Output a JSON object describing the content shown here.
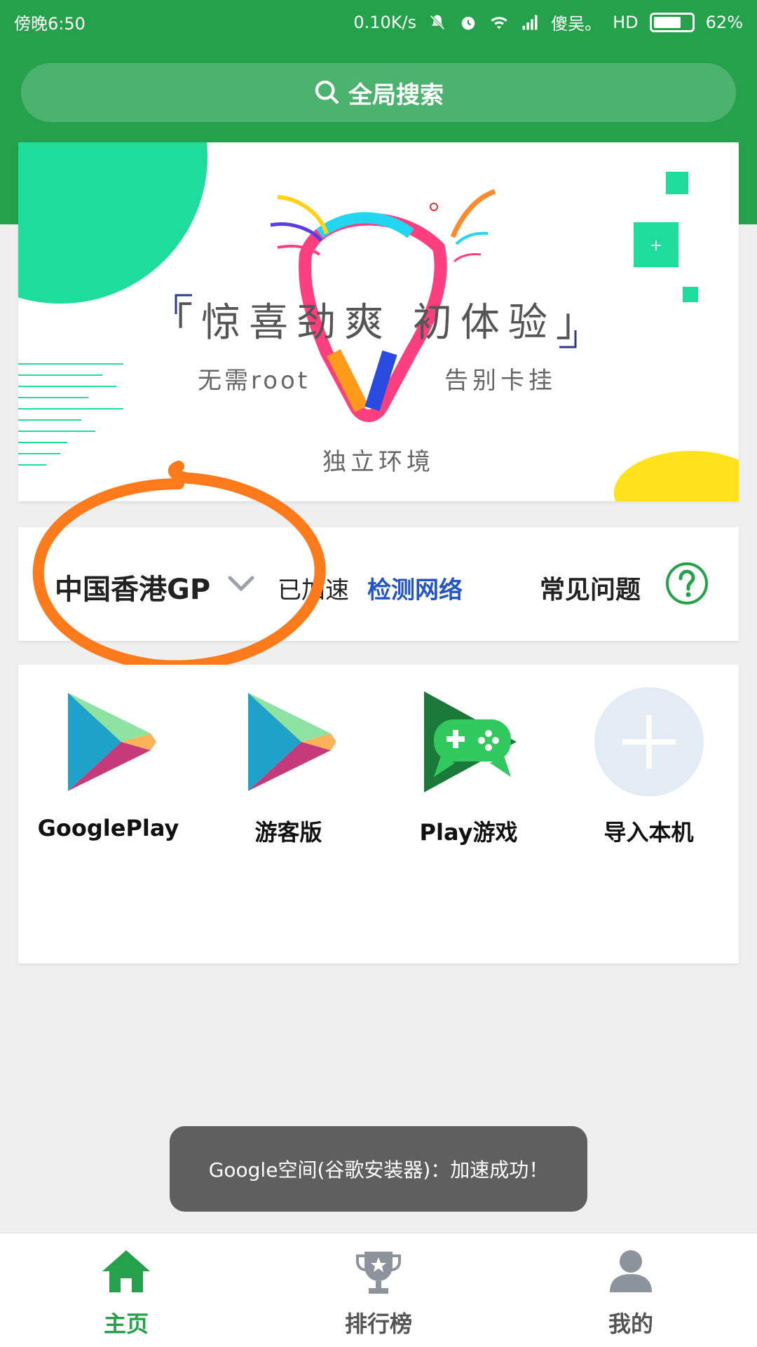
{
  "status_bar": {
    "time": "傍晚6:50",
    "speed": "0.10K/s",
    "carrier": "傻吴。",
    "hd": "HD",
    "battery": "62%"
  },
  "search": {
    "label": "全局搜索"
  },
  "banner": {
    "title": "「惊喜劲爽  初体验」",
    "sub_left": "无需root",
    "sub_right": "告别卡挂",
    "sub_bottom": "独立环境"
  },
  "region": {
    "name": "中国香港GP",
    "status": "已加速",
    "check_network": "检测网络",
    "faq": "常见问题"
  },
  "apps": [
    {
      "label": "GooglePlay",
      "icon": "google-play-icon"
    },
    {
      "label": "游客版",
      "icon": "google-play-icon"
    },
    {
      "label": "Play游戏",
      "icon": "play-games-icon"
    },
    {
      "label": "导入本机",
      "icon": "add-icon"
    }
  ],
  "toast": {
    "text": "Google空间(谷歌安装器)：加速成功！"
  },
  "bottom_nav": [
    {
      "label": "主页",
      "icon": "home-icon",
      "active": true
    },
    {
      "label": "排行榜",
      "icon": "trophy-icon",
      "active": false
    },
    {
      "label": "我的",
      "icon": "person-icon",
      "active": false
    }
  ],
  "colors": {
    "primary_green": "#24a14a",
    "link_blue": "#2355c4",
    "annotation_orange": "#ff7a1a",
    "inactive_gray": "#8c939c"
  }
}
